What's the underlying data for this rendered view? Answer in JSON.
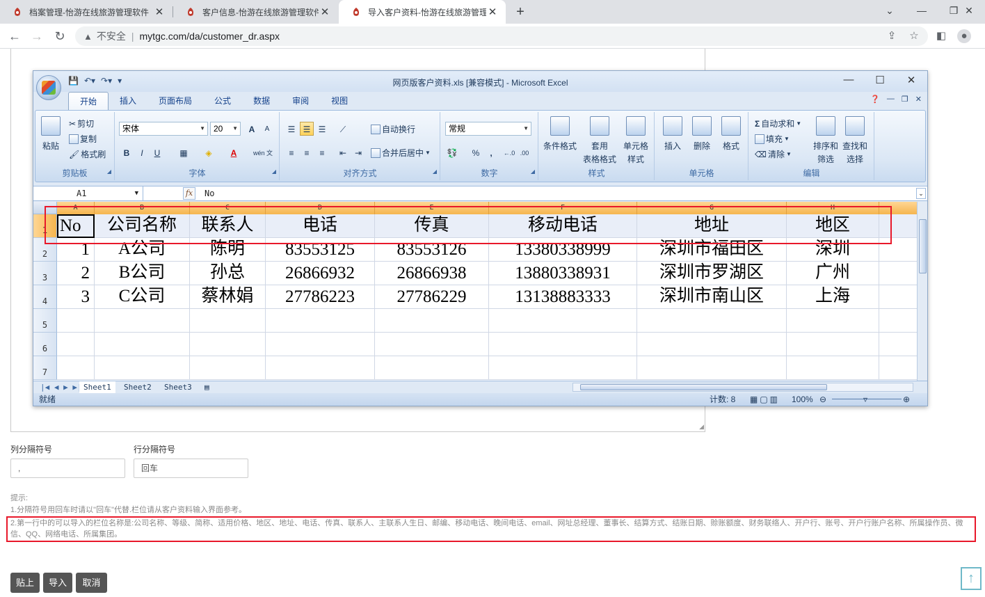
{
  "browser": {
    "tabs": [
      {
        "title": "档案管理-怡游在线旅游管理软件"
      },
      {
        "title": "客户信息-怡游在线旅游管理软件"
      },
      {
        "title": "导入客户资料-怡游在线旅游管理"
      }
    ],
    "insecure_label": "不安全",
    "url": "mytgc.com/da/customer_dr.aspx"
  },
  "excel": {
    "title": "网页版客户资料.xls  [兼容模式] - Microsoft Excel",
    "ribbon_tabs": [
      "开始",
      "插入",
      "页面布局",
      "公式",
      "数据",
      "审阅",
      "视图"
    ],
    "clipboard": {
      "paste": "粘贴",
      "cut": "剪切",
      "copy": "复制",
      "format_painter": "格式刷",
      "label": "剪贴板"
    },
    "font": {
      "name": "宋体",
      "size": "20",
      "label": "字体",
      "bold": "B",
      "italic": "I",
      "underline": "U",
      "wen": "wén 文",
      "grow": "A",
      "shrink": "A"
    },
    "alignment": {
      "wrap": "自动换行",
      "merge": "合并后居中",
      "label": "对齐方式"
    },
    "number": {
      "format": "常规",
      "percent": "%",
      "comma": ",",
      "label": "数字"
    },
    "styles": {
      "cond": "条件格式",
      "table1": "套用",
      "table2": "表格格式",
      "cell1": "单元格",
      "cell2": "样式",
      "label": "样式"
    },
    "cells": {
      "insert": "插入",
      "delete": "删除",
      "format": "格式",
      "label": "单元格"
    },
    "editing": {
      "autosum": "自动求和",
      "fill": "填充",
      "clear": "清除",
      "sort1": "排序和",
      "sort2": "筛选",
      "find1": "查找和",
      "find2": "选择",
      "label": "编辑",
      "sigma": "Σ"
    },
    "name_box": "A1",
    "formula_value": "No",
    "fx": "fx",
    "columns": [
      "A",
      "B",
      "C",
      "D",
      "E",
      "F",
      "G",
      "H"
    ],
    "rows": [
      [
        "No",
        "公司名称",
        "联系人",
        "电话",
        "传真",
        "移动电话",
        "地址",
        "地区"
      ],
      [
        "1",
        "A公司",
        "陈明",
        "83553125",
        "83553126",
        "13380338999",
        "深圳市福田区",
        "深圳"
      ],
      [
        "2",
        "B公司",
        "孙总",
        "26866932",
        "26866938",
        "13880338931",
        "深圳市罗湖区",
        "广州"
      ],
      [
        "3",
        "C公司",
        "蔡林娟",
        "27786223",
        "27786229",
        "13138883333",
        "深圳市南山区",
        "上海"
      ],
      [
        "",
        "",
        "",
        "",
        "",
        "",
        "",
        ""
      ],
      [
        "",
        "",
        "",
        "",
        "",
        "",
        "",
        ""
      ],
      [
        "",
        "",
        "",
        "",
        "",
        "",
        "",
        ""
      ]
    ],
    "row_numbers": [
      "1",
      "2",
      "3",
      "4",
      "5",
      "6",
      "7"
    ],
    "sheets": [
      "Sheet1",
      "Sheet2",
      "Sheet3"
    ],
    "status_ready": "就绪",
    "status_count": "计数: 8",
    "zoom": "100%"
  },
  "form": {
    "col_sep_label": "列分隔符号",
    "col_sep_value": ",",
    "row_sep_label": "行分隔符号",
    "row_sep_value": "回车",
    "tip_title": "提示:",
    "tip1": "1.分隔符号用回车时请以\"回车\"代替.栏位请从客户资料输入界面参考。",
    "tip2": "2.第一行中的可以导入的栏位名称是:公司名称、等级、简称、适用价格、地区、地址、电话、传真、联系人、主联系人生日、邮编、移动电话、晚间电话、email、网址总经理、董事长、结算方式、结账日期、赊账额度、财务联络人、开户行、账号、开户行账户名称、所属操作员、微信、QQ、网络电话、所属集团。",
    "buttons": {
      "paste": "贴上",
      "import": "导入",
      "cancel": "取消"
    }
  }
}
